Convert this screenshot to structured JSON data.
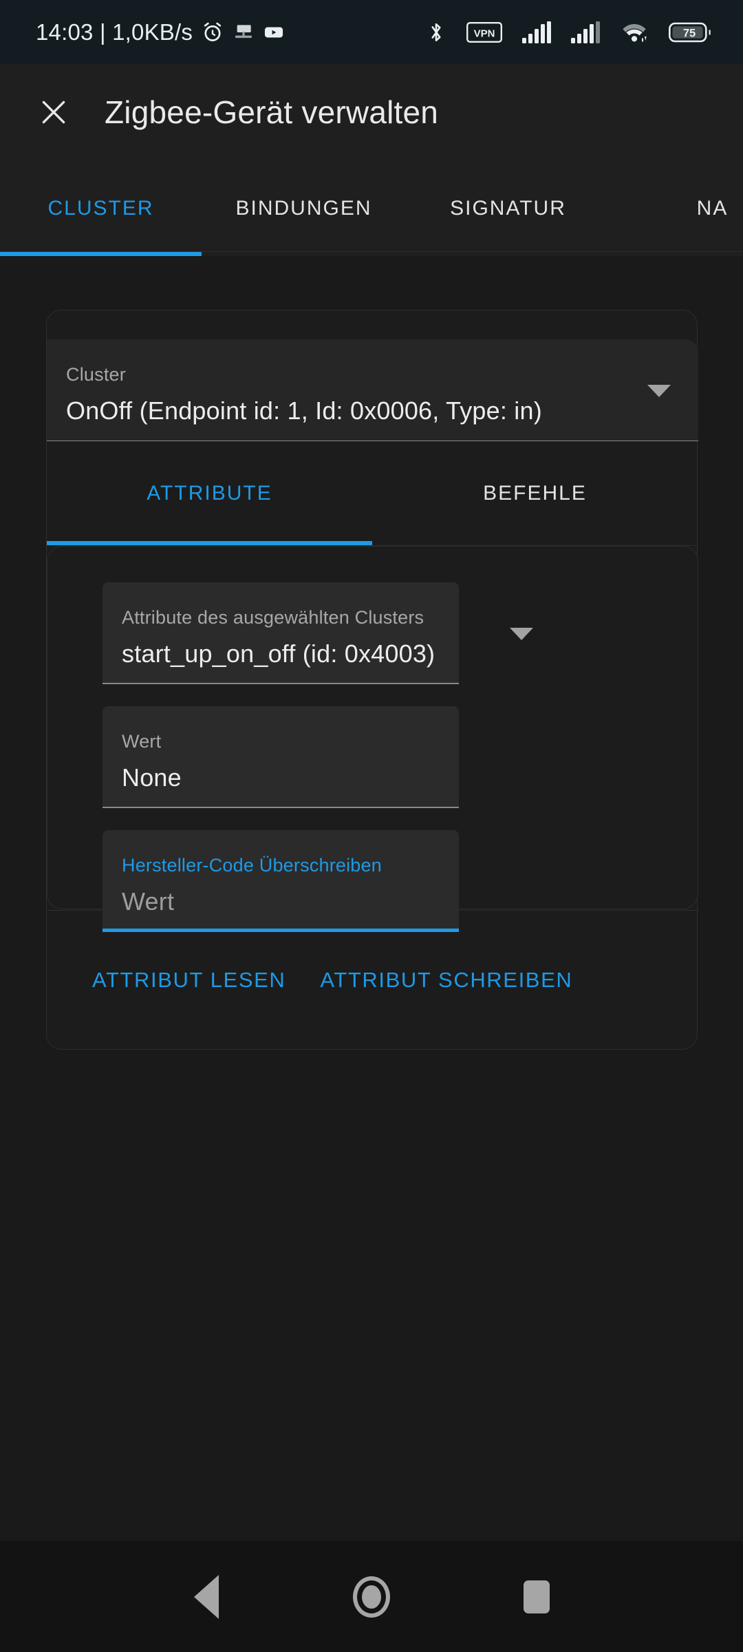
{
  "statusbar": {
    "clock": "14:03 | 1,0KB/s",
    "left_icons": [
      "alarm-icon",
      "cast-icon",
      "youtube-icon"
    ],
    "right_icons": [
      "bluetooth-icon",
      "vpn-icon",
      "signal-sim1-icon",
      "signal-sim2-icon",
      "wifi-icon",
      "battery-icon"
    ],
    "vpn_label": "VPN",
    "battery_level": "75"
  },
  "toolbar": {
    "close_label": "✕",
    "title": "Zigbee-Gerät verwalten"
  },
  "tabs": [
    {
      "label": "CLUSTER",
      "active": true
    },
    {
      "label": "BINDUNGEN",
      "active": false
    },
    {
      "label": "SIGNATUR",
      "active": false
    },
    {
      "label": "NA",
      "active": false
    }
  ],
  "cluster_select": {
    "label": "Cluster",
    "value": "OnOff (Endpoint id: 1, Id: 0x0006, Type: in)"
  },
  "inner_tabs": [
    {
      "label": "ATTRIBUTE",
      "active": true
    },
    {
      "label": "BEFEHLE",
      "active": false
    }
  ],
  "attribute_select": {
    "label": "Attribute des ausgewählten Clusters",
    "value": "start_up_on_off (id: 0x4003)"
  },
  "value_field": {
    "label": "Wert",
    "value": "None"
  },
  "manufacturer_field": {
    "label": "Hersteller-Code Überschreiben",
    "placeholder": "Wert",
    "value": ""
  },
  "actions": {
    "read_label": "ATTRIBUT LESEN",
    "write_label": "ATTRIBUT SCHREIBEN"
  },
  "navbar": {
    "back": "back-icon",
    "home": "home-icon",
    "recents": "recents-icon"
  },
  "colors": {
    "accent": "#1e9ae6",
    "background": "#1a1a1a",
    "surface": "#1f1f1f",
    "field": "#2b2b2b",
    "statusbar": "#131c21"
  }
}
